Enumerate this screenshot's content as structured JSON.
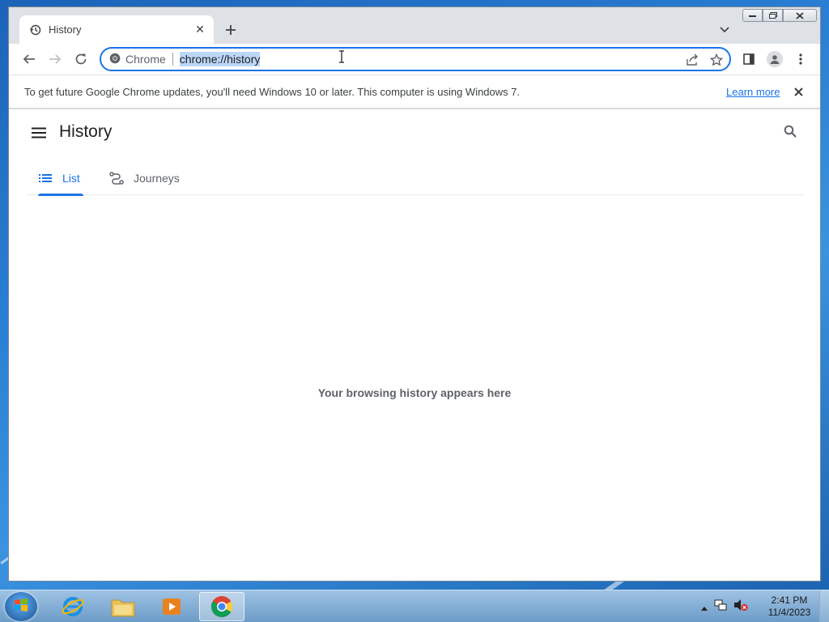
{
  "browser": {
    "tab": {
      "title": "History",
      "icon": "history-icon"
    },
    "omnibox": {
      "chip_label": "Chrome",
      "url": "chrome://history"
    },
    "infobar": {
      "message": "To get future Google Chrome updates, you'll need Windows 10 or later. This computer is using Windows 7.",
      "link": "Learn more"
    }
  },
  "page": {
    "title": "History",
    "tabs": [
      {
        "label": "List",
        "icon": "list-icon",
        "selected": true
      },
      {
        "label": "Journeys",
        "icon": "journeys-icon",
        "selected": false
      }
    ],
    "empty_message": "Your browsing history appears here"
  },
  "taskbar": {
    "apps": [
      "internet-explorer-icon",
      "file-explorer-icon",
      "media-player-icon",
      "chrome-icon"
    ],
    "clock": {
      "time": "2:41 PM",
      "date": "11/4/2023"
    }
  },
  "colors": {
    "accent": "#1a73e8",
    "text_secondary": "#5f6368",
    "text_primary": "#202124"
  }
}
